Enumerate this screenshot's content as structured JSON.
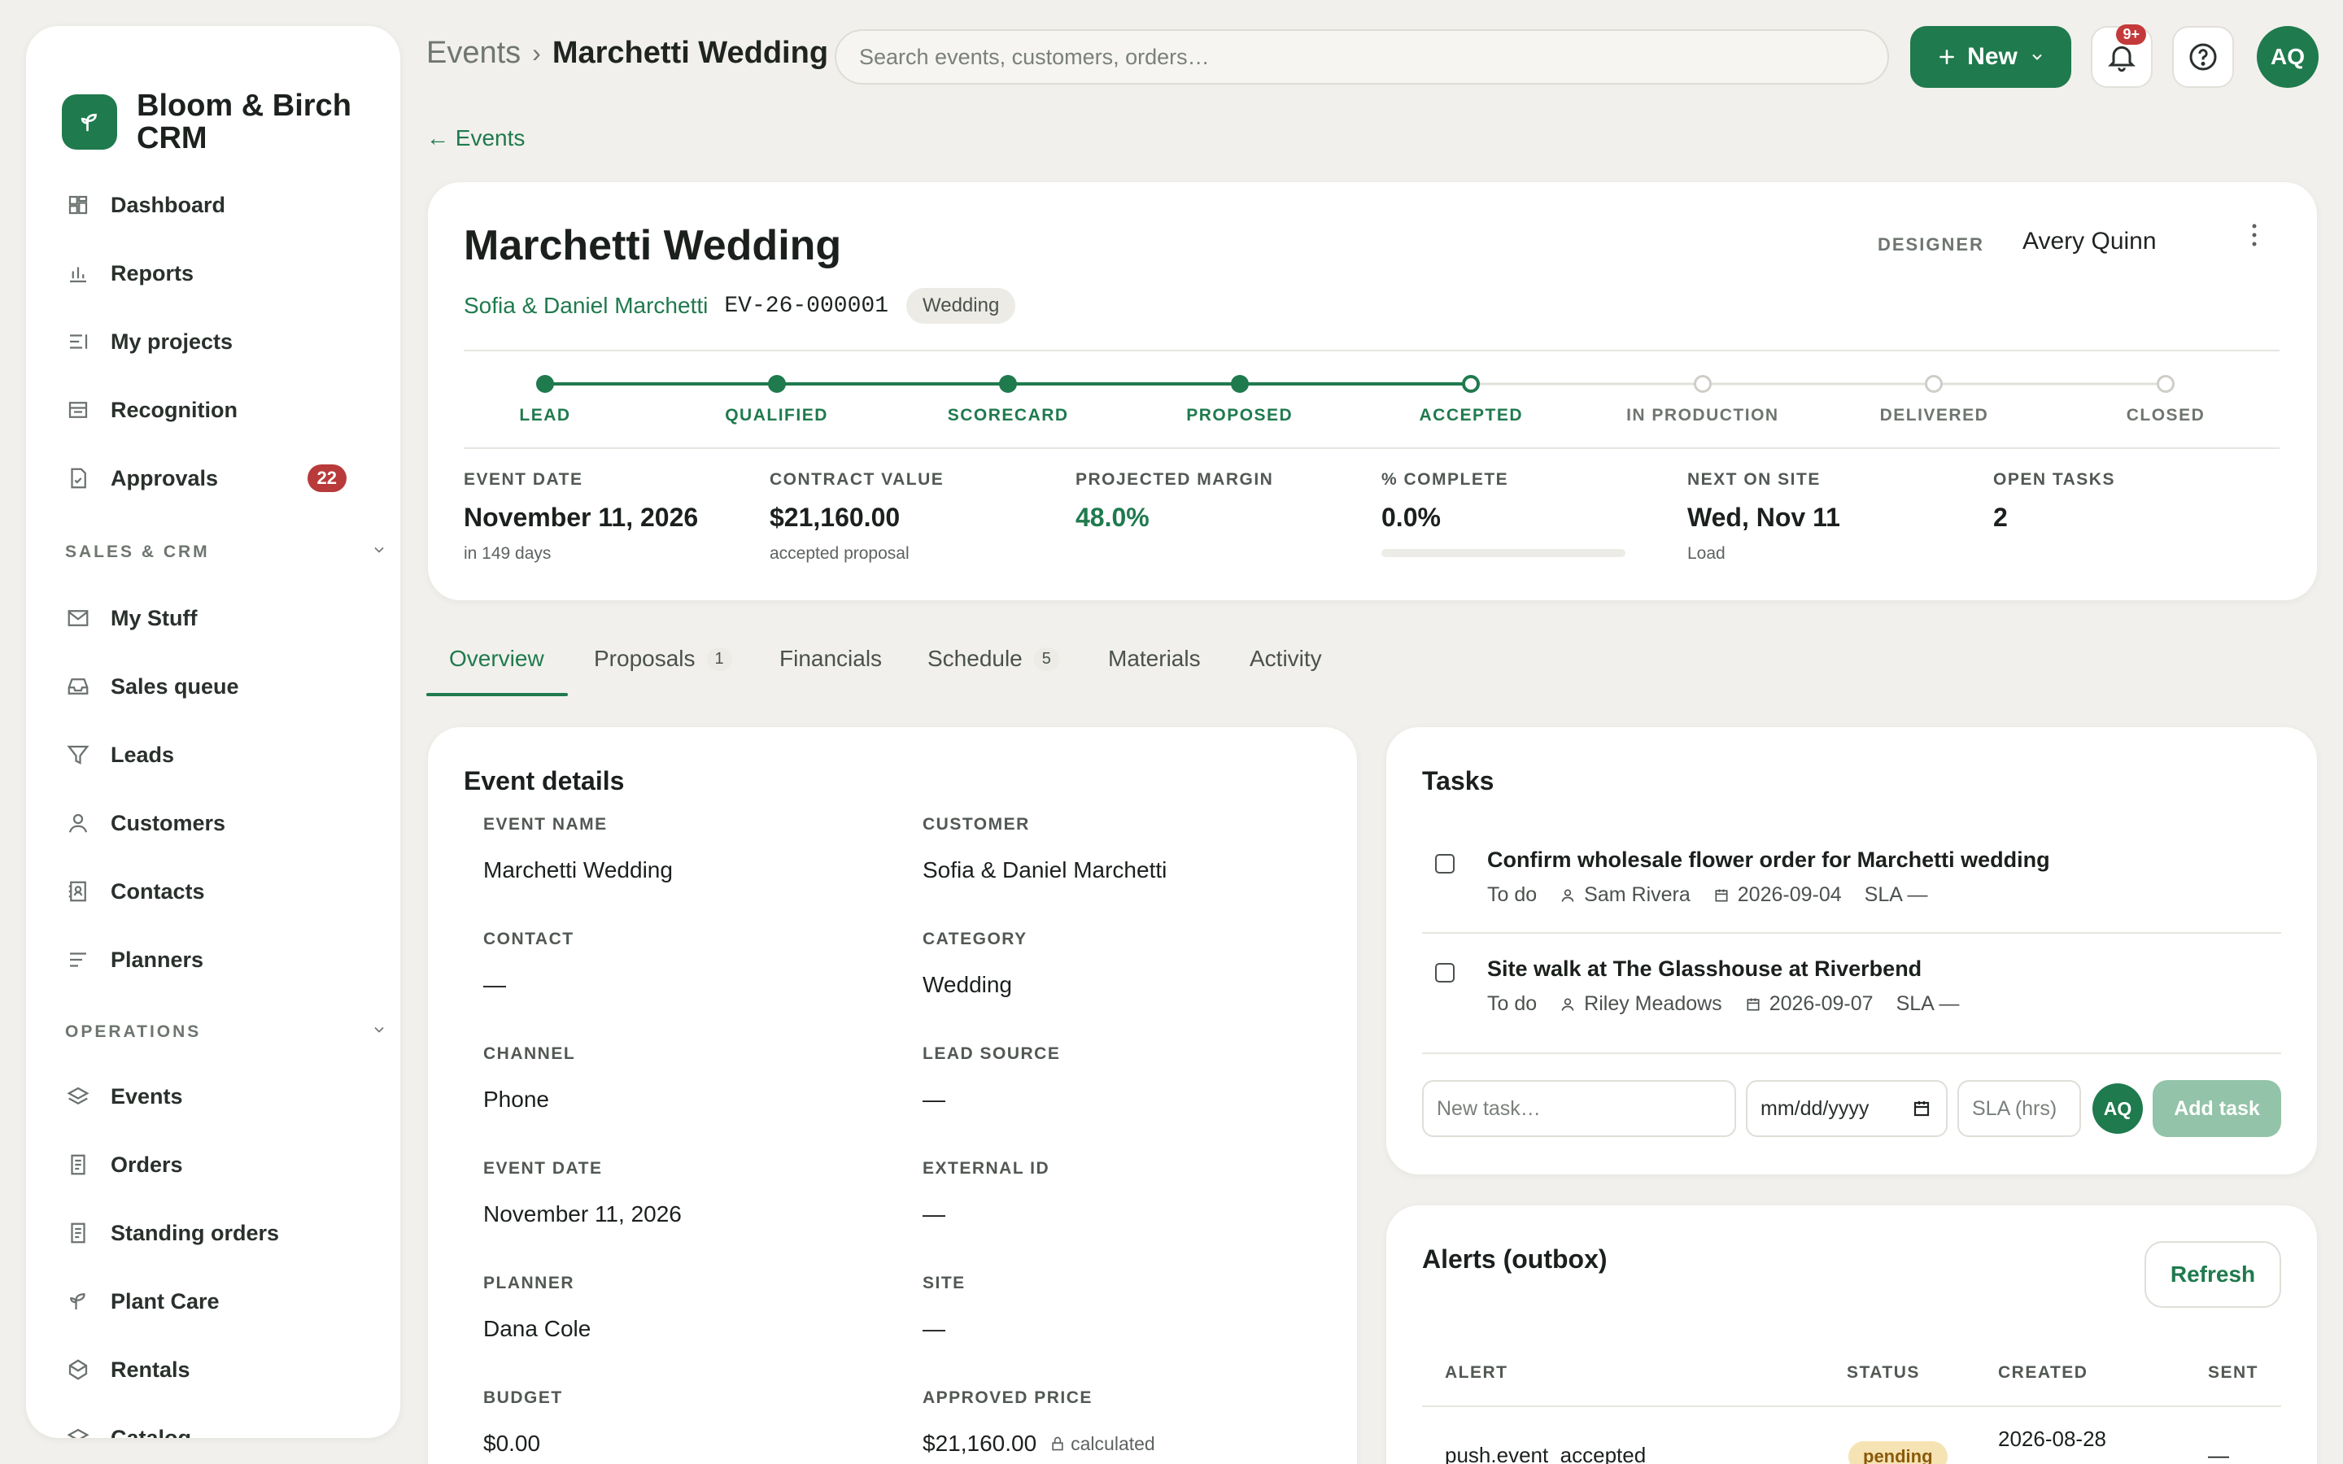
{
  "brand": {
    "name_line1": "Bloom & Birch",
    "name_line2": "CRM"
  },
  "sidebar": {
    "items_top": [
      {
        "label": "Dashboard",
        "icon": "dashboard-icon"
      },
      {
        "label": "Reports",
        "icon": "bar-chart-icon"
      },
      {
        "label": "My projects",
        "icon": "list-icon"
      },
      {
        "label": "Recognition",
        "icon": "card-icon"
      },
      {
        "label": "Approvals",
        "icon": "file-check-icon",
        "badge": "22"
      }
    ],
    "section_sales": "SALES & CRM",
    "items_sales": [
      {
        "label": "My Stuff",
        "icon": "mail-icon"
      },
      {
        "label": "Sales queue",
        "icon": "inbox-icon"
      },
      {
        "label": "Leads",
        "icon": "filter-icon"
      },
      {
        "label": "Customers",
        "icon": "user-icon"
      },
      {
        "label": "Contacts",
        "icon": "contact-book-icon"
      },
      {
        "label": "Planners",
        "icon": "lines-icon"
      }
    ],
    "section_ops": "OPERATIONS",
    "items_ops": [
      {
        "label": "Events",
        "icon": "layers-icon"
      },
      {
        "label": "Orders",
        "icon": "receipt-icon"
      },
      {
        "label": "Standing orders",
        "icon": "receipt-icon"
      },
      {
        "label": "Plant Care",
        "icon": "sprout-icon"
      },
      {
        "label": "Rentals",
        "icon": "box-icon"
      },
      {
        "label": "Catalog",
        "icon": "layers-icon"
      }
    ]
  },
  "topbar": {
    "crumb_parent": "Events",
    "crumb_sep": "›",
    "crumb_current": "Marchetti Wedding",
    "search_placeholder": "Search events, customers, orders…",
    "new_label": "New",
    "notif_badge": "9+",
    "avatar": "AQ"
  },
  "back_link": "← Events",
  "event": {
    "title": "Marchetti Wedding",
    "customer": "Sofia & Daniel Marchetti",
    "id": "EV-26-000001",
    "category_chip": "Wedding",
    "designer_label": "DESIGNER",
    "designer": "Avery Quinn",
    "stages": [
      {
        "label": "LEAD",
        "state": "done"
      },
      {
        "label": "QUALIFIED",
        "state": "done"
      },
      {
        "label": "SCORECARD",
        "state": "done"
      },
      {
        "label": "PROPOSED",
        "state": "done"
      },
      {
        "label": "ACCEPTED",
        "state": "current"
      },
      {
        "label": "IN PRODUCTION",
        "state": "todo"
      },
      {
        "label": "DELIVERED",
        "state": "todo"
      },
      {
        "label": "CLOSED",
        "state": "todo"
      }
    ],
    "metrics": [
      {
        "label": "EVENT DATE",
        "value": "November 11, 2026",
        "sub": "in 149 days"
      },
      {
        "label": "CONTRACT VALUE",
        "value": "$21,160.00",
        "sub": "accepted proposal"
      },
      {
        "label": "PROJECTED MARGIN",
        "value": "48.0%",
        "sub": ""
      },
      {
        "label": "% COMPLETE",
        "value": "0.0%",
        "sub": "",
        "progress": 0
      },
      {
        "label": "NEXT ON SITE",
        "value": "Wed, Nov 11",
        "sub": "Load"
      },
      {
        "label": "OPEN TASKS",
        "value": "2",
        "sub": ""
      }
    ]
  },
  "tabs": [
    {
      "label": "Overview",
      "count": ""
    },
    {
      "label": "Proposals",
      "count": "1"
    },
    {
      "label": "Financials",
      "count": ""
    },
    {
      "label": "Schedule",
      "count": "5"
    },
    {
      "label": "Materials",
      "count": ""
    },
    {
      "label": "Activity",
      "count": ""
    }
  ],
  "details": {
    "title": "Event details",
    "fields": [
      {
        "label": "EVENT NAME",
        "value": "Marchetti Wedding"
      },
      {
        "label": "CUSTOMER",
        "value": "Sofia & Daniel Marchetti"
      },
      {
        "label": "CONTACT",
        "value": "—"
      },
      {
        "label": "CATEGORY",
        "value": "Wedding"
      },
      {
        "label": "CHANNEL",
        "value": "Phone"
      },
      {
        "label": "LEAD SOURCE",
        "value": "—"
      },
      {
        "label": "EVENT DATE",
        "value": "November 11, 2026"
      },
      {
        "label": "EXTERNAL ID",
        "value": "—"
      },
      {
        "label": "PLANNER",
        "value": "Dana Cole"
      },
      {
        "label": "SITE",
        "value": "—"
      },
      {
        "label": "BUDGET",
        "value": "$0.00"
      },
      {
        "label": "APPROVED PRICE",
        "value": "$21,160.00",
        "note": "calculated"
      }
    ]
  },
  "tasks": {
    "title": "Tasks",
    "items": [
      {
        "title": "Confirm wholesale flower order for Marchetti wedding",
        "status": "To do",
        "assignee": "Sam Rivera",
        "due": "2026-09-04",
        "sla": "SLA —"
      },
      {
        "title": "Site walk at The Glasshouse at Riverbend",
        "status": "To do",
        "assignee": "Riley Meadows",
        "due": "2026-09-07",
        "sla": "SLA —"
      }
    ],
    "new_placeholder": "New task…",
    "date_placeholder": "mm/dd/yyyy",
    "sla_placeholder": "SLA (hrs)",
    "assignee": "AQ",
    "add_label": "Add task"
  },
  "alerts": {
    "title": "Alerts (outbox)",
    "refresh_label": "Refresh",
    "columns": [
      "ALERT",
      "STATUS",
      "CREATED",
      "SENT"
    ],
    "rows": [
      {
        "alert": "push.event_accepted",
        "status": "pending",
        "created": "2026-08-28",
        "sent": "—"
      }
    ]
  },
  "colors": {
    "accent": "#1f7a4d",
    "badge": "#b83a3a",
    "pending_bg": "#f6e3b4"
  }
}
